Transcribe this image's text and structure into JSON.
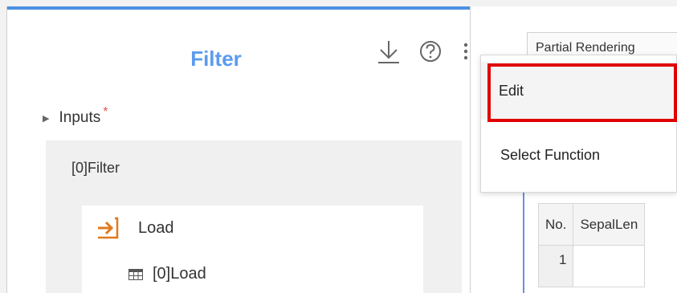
{
  "panel": {
    "title": "Filter",
    "inputs_label": "Inputs",
    "required_mark": "*",
    "filter_node_label": "[0]Filter",
    "load_label": "Load",
    "load_output_label": "[0]Load"
  },
  "right": {
    "tab_label": "Partial Rendering",
    "table": {
      "headers": [
        "No.",
        "SepalLen"
      ],
      "rows": [
        [
          "1",
          ""
        ]
      ]
    }
  },
  "menu": {
    "items": [
      {
        "label": "Edit"
      },
      {
        "label": "Select Function"
      }
    ]
  },
  "colors": {
    "accent": "#4a90e2",
    "title": "#5b9bf0",
    "load_icon": "#e07a1f",
    "highlight": "#e00000"
  },
  "icons": {
    "download": "download-icon",
    "help": "help-icon",
    "more": "more-vertical-icon",
    "load": "arrow-into-box-icon",
    "table": "table-icon"
  }
}
